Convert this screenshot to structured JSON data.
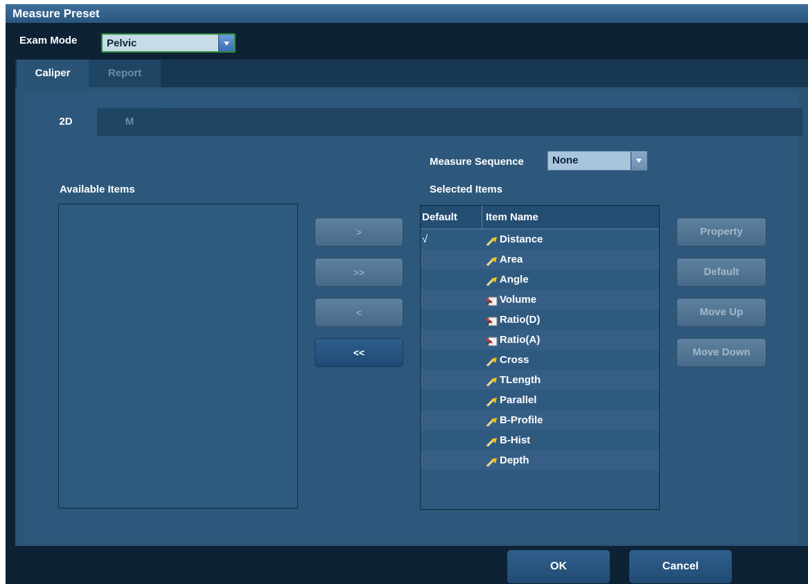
{
  "window": {
    "title": "Measure Preset"
  },
  "exam_mode": {
    "label": "Exam Mode",
    "value": "Pelvic"
  },
  "tabs": [
    {
      "label": "Caliper",
      "active": true
    },
    {
      "label": "Report",
      "active": false
    }
  ],
  "subtabs": [
    {
      "label": "2D",
      "active": true
    },
    {
      "label": "M",
      "active": false
    }
  ],
  "measure_sequence": {
    "label": "Measure Sequence",
    "value": "None"
  },
  "available": {
    "label": "Available Items"
  },
  "selected": {
    "label": "Selected Items",
    "columns": [
      "Default",
      "Item Name"
    ],
    "rows": [
      {
        "default": "√",
        "name": "Distance",
        "icon": "caliper-icon"
      },
      {
        "default": "",
        "name": "Area",
        "icon": "caliper-icon"
      },
      {
        "default": "",
        "name": "Angle",
        "icon": "caliper-icon"
      },
      {
        "default": "",
        "name": "Volume",
        "icon": "study-icon"
      },
      {
        "default": "",
        "name": "Ratio(D)",
        "icon": "study-icon"
      },
      {
        "default": "",
        "name": "Ratio(A)",
        "icon": "study-icon"
      },
      {
        "default": "",
        "name": "Cross",
        "icon": "caliper-icon"
      },
      {
        "default": "",
        "name": "TLength",
        "icon": "caliper-icon"
      },
      {
        "default": "",
        "name": "Parallel",
        "icon": "caliper-icon"
      },
      {
        "default": "",
        "name": "B-Profile",
        "icon": "caliper-icon"
      },
      {
        "default": "",
        "name": "B-Hist",
        "icon": "caliper-icon"
      },
      {
        "default": "",
        "name": "Depth",
        "icon": "caliper-icon"
      }
    ]
  },
  "transfer_buttons": [
    ">",
    ">>",
    "<",
    "<<"
  ],
  "side_buttons": [
    "Property",
    "Default",
    "Move Up",
    "Move Down"
  ],
  "footer": {
    "ok": "OK",
    "cancel": "Cancel"
  }
}
